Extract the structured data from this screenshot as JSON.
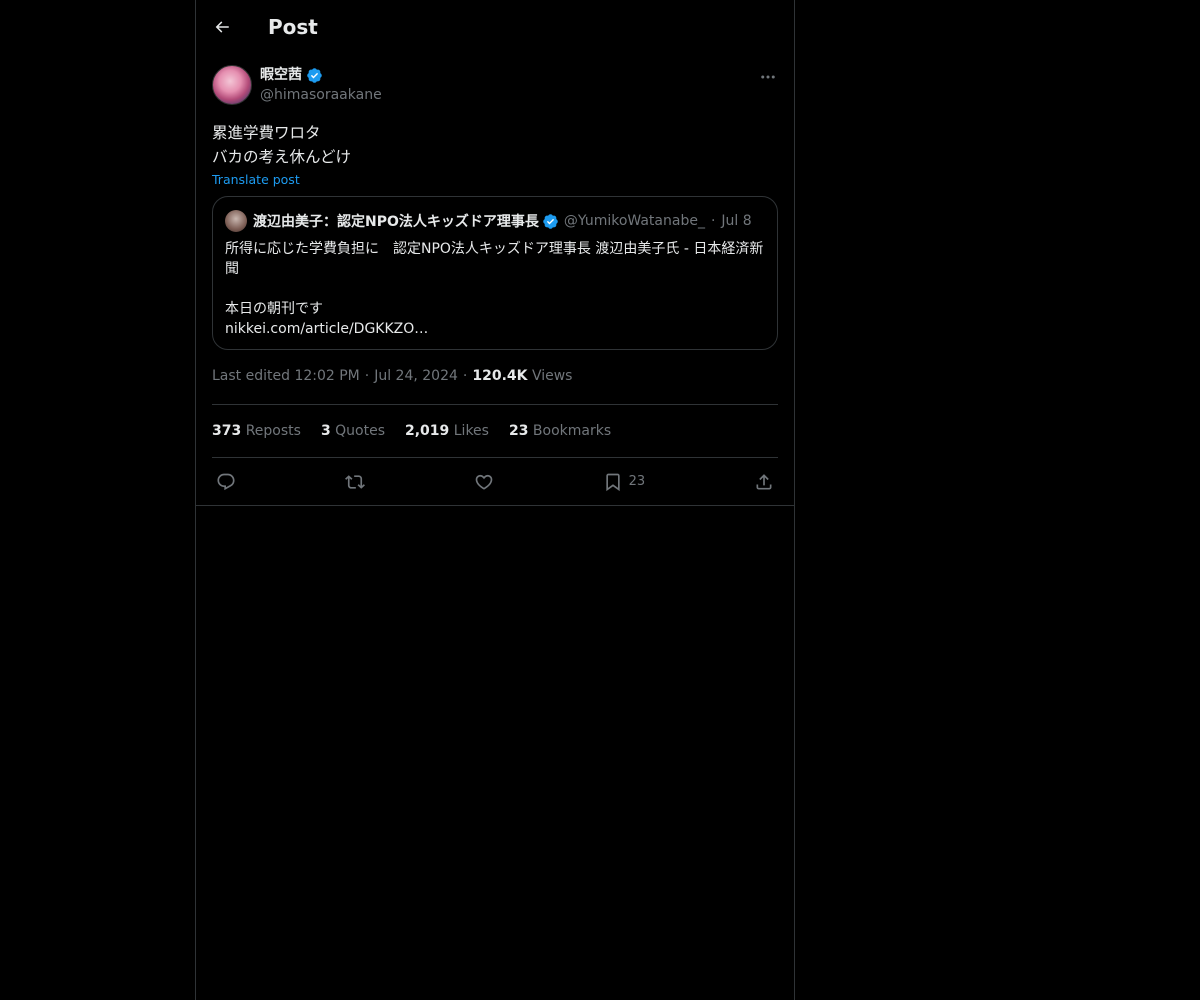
{
  "header": {
    "title": "Post"
  },
  "post": {
    "author": {
      "display_name": "暇空茜",
      "handle": "@himasoraakane"
    },
    "text_line1": "累進学費ワロタ",
    "text_line2": "バカの考え休んどけ",
    "translate_label": "Translate post",
    "quote": {
      "display_name": "渡辺由美子：認定NPO法人キッズドア理事長",
      "handle": "@YumikoWatanabe_",
      "separator": "·",
      "date": "Jul 8",
      "body": "所得に応じた学費負担に　認定NPO法人キッズドア理事長 渡辺由美子氏 - 日本経済新聞\n\n本日の朝刊です\n nikkei.com/article/DGKKZO…"
    },
    "meta": {
      "edited": "Last edited 12:02 PM",
      "date": "Jul 24, 2024",
      "separator": "·",
      "views_count": "120.4K",
      "views_label": "Views"
    },
    "stats": {
      "reposts_count": "373",
      "reposts_label": "Reposts",
      "quotes_count": "3",
      "quotes_label": "Quotes",
      "likes_count": "2,019",
      "likes_label": "Likes",
      "bookmarks_count": "23",
      "bookmarks_label": "Bookmarks"
    },
    "actions": {
      "reply_icon": "reply-icon",
      "repost_icon": "repost-icon",
      "like_icon": "heart-icon",
      "bookmark_icon": "bookmark-icon",
      "bookmark_count": "23",
      "share_icon": "share-icon"
    }
  },
  "colors": {
    "background": "#000000",
    "text": "#e7e9ea",
    "muted": "#71767b",
    "accent": "#1d9bf0",
    "border": "#2f3336"
  }
}
